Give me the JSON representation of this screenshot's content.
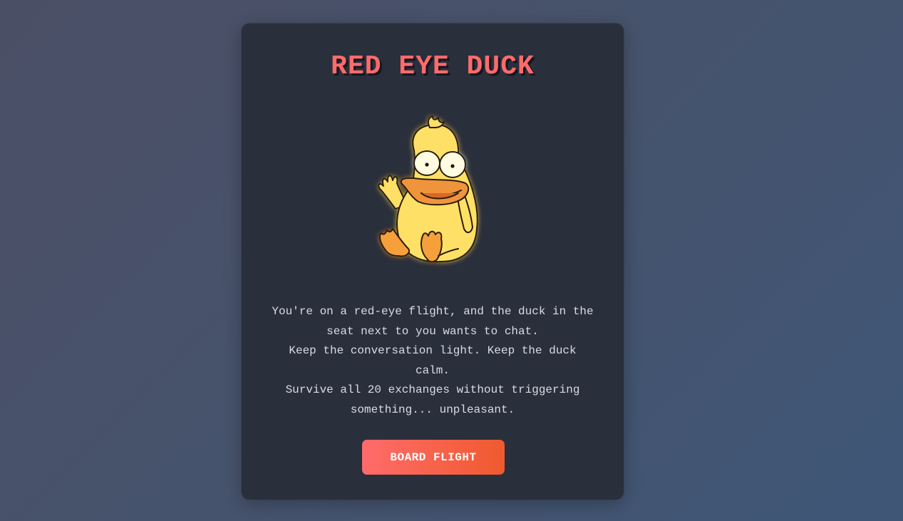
{
  "title": "RED EYE DUCK",
  "illustration": {
    "icon": "duck-illustration",
    "colors": {
      "body": "#ffe066",
      "beak": "#f0943a",
      "feet": "#f5a03a",
      "outline": "#2a1f0f",
      "glow": "#f7c948"
    }
  },
  "description": {
    "line1": "You're on a red-eye flight, and the duck in the seat next to you wants to chat.",
    "line2": "Keep the conversation light. Keep the duck calm.",
    "line3": "Survive all 20 exchanges without triggering something... unpleasant."
  },
  "button": {
    "label": "BOARD FLIGHT"
  },
  "colors": {
    "accent": "#ff6b6b",
    "card": "#2a2f3c",
    "text": "#d9dce3"
  }
}
